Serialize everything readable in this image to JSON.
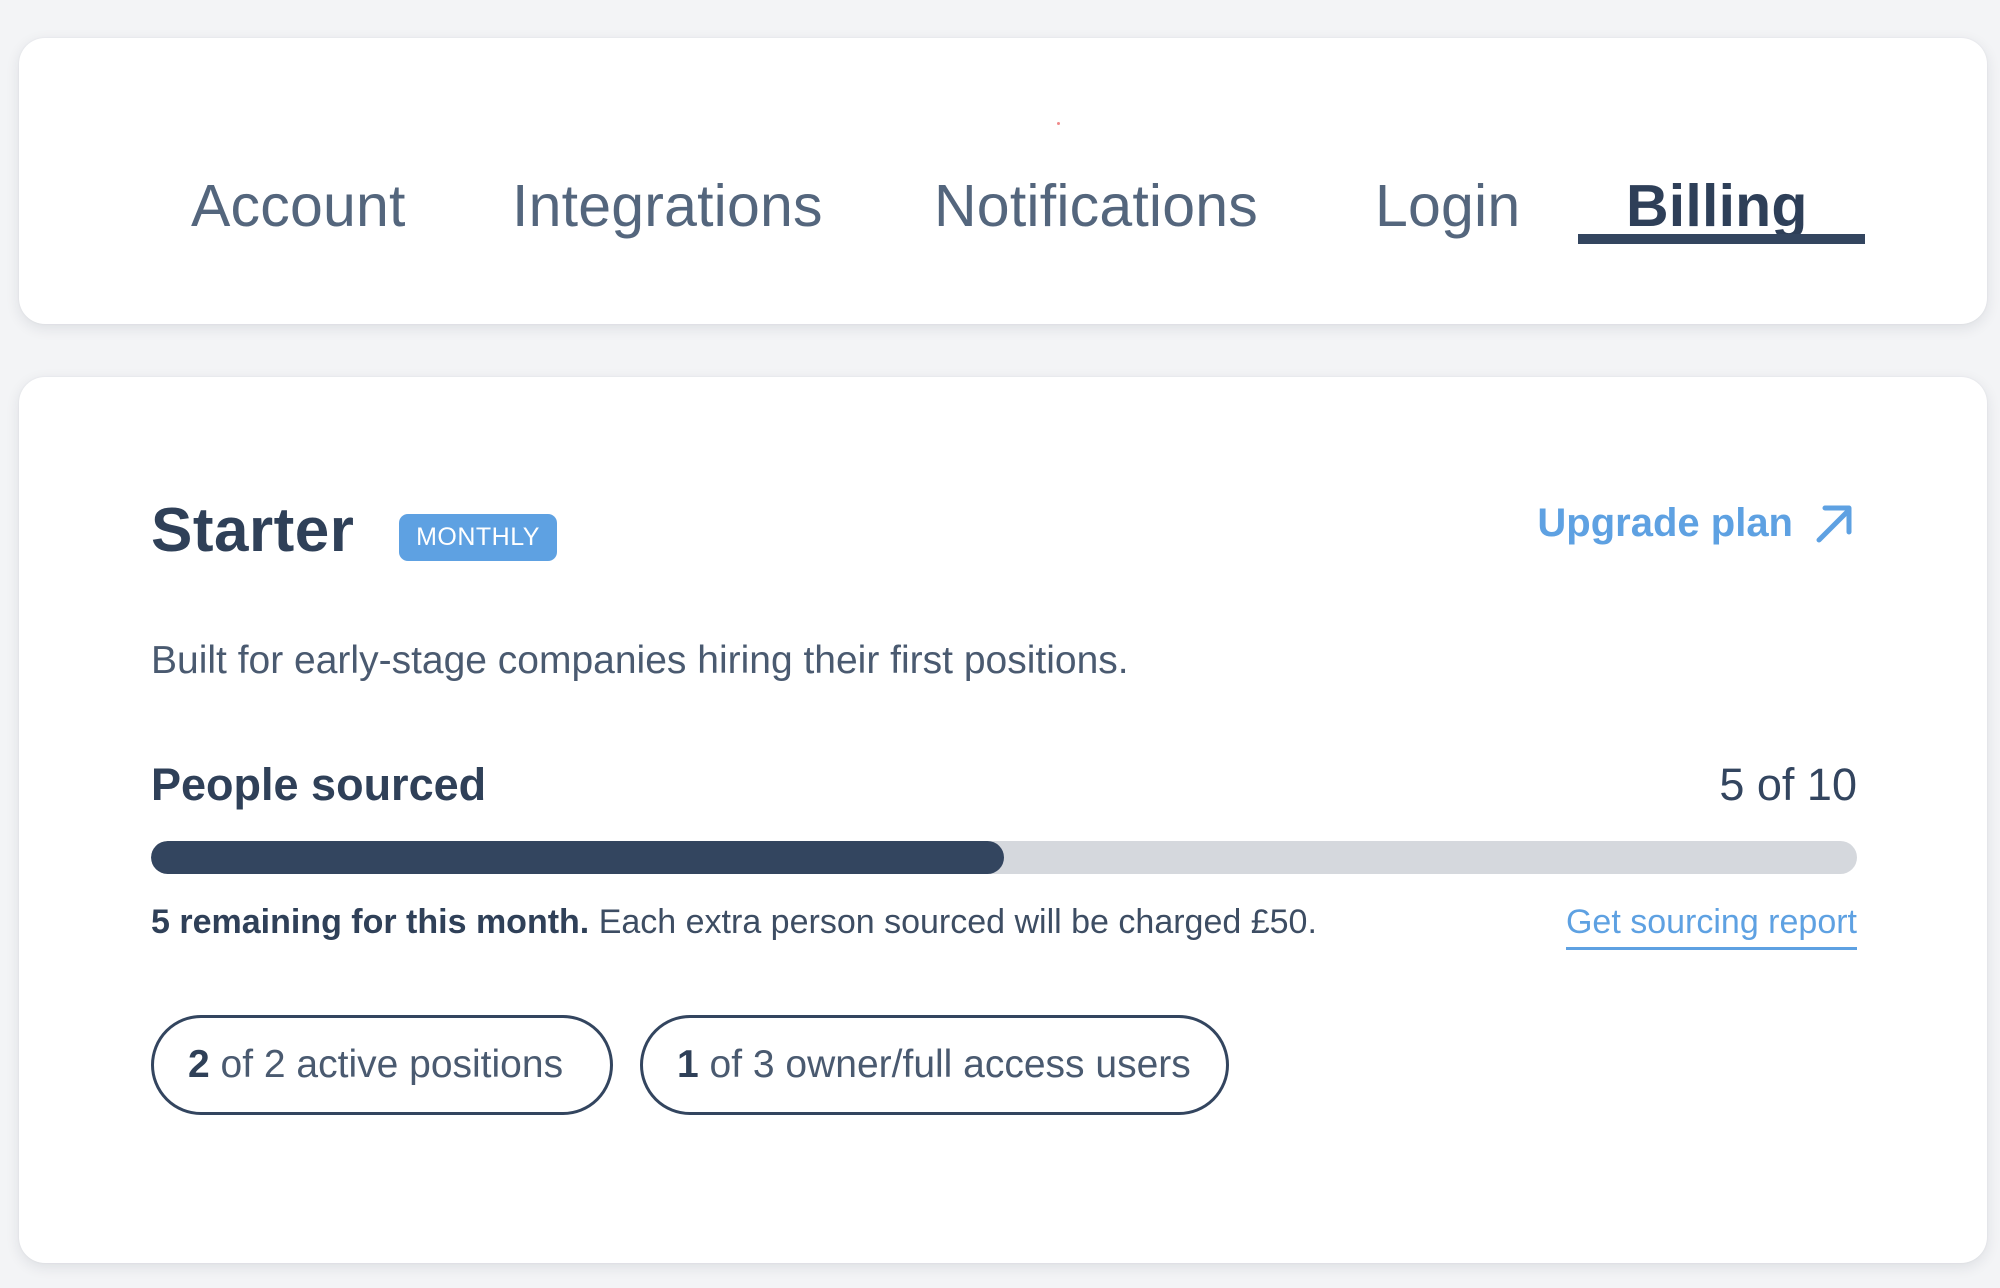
{
  "tabs": [
    {
      "label": "Account",
      "active": false
    },
    {
      "label": "Integrations",
      "active": false
    },
    {
      "label": "Notifications",
      "active": false
    },
    {
      "label": "Login",
      "active": false
    },
    {
      "label": "Billing",
      "active": true
    }
  ],
  "plan": {
    "name": "Starter",
    "badge": "MONTHLY",
    "upgrade_label": "Upgrade plan",
    "upgrade_icon": "arrow-up-right-icon",
    "description": "Built for early-stage companies hiring their first positions."
  },
  "usage": {
    "label": "People sourced",
    "used": 5,
    "limit": 10,
    "count_text": "5 of 10",
    "progress_fraction": 0.5,
    "remaining_bold": "5 remaining for this month.",
    "remaining_note": " Each extra person sourced will be charged £50.",
    "report_link": "Get sourcing report"
  },
  "limits": [
    {
      "bold": "2",
      "text": " of 2 active positions"
    },
    {
      "bold": "1",
      "text": " of 3 owner/full access users"
    }
  ],
  "colors": {
    "accent": "#5ea1e2",
    "primary_dark": "#33455f",
    "track": "#d5d8dd",
    "background": "#f3f4f6"
  }
}
